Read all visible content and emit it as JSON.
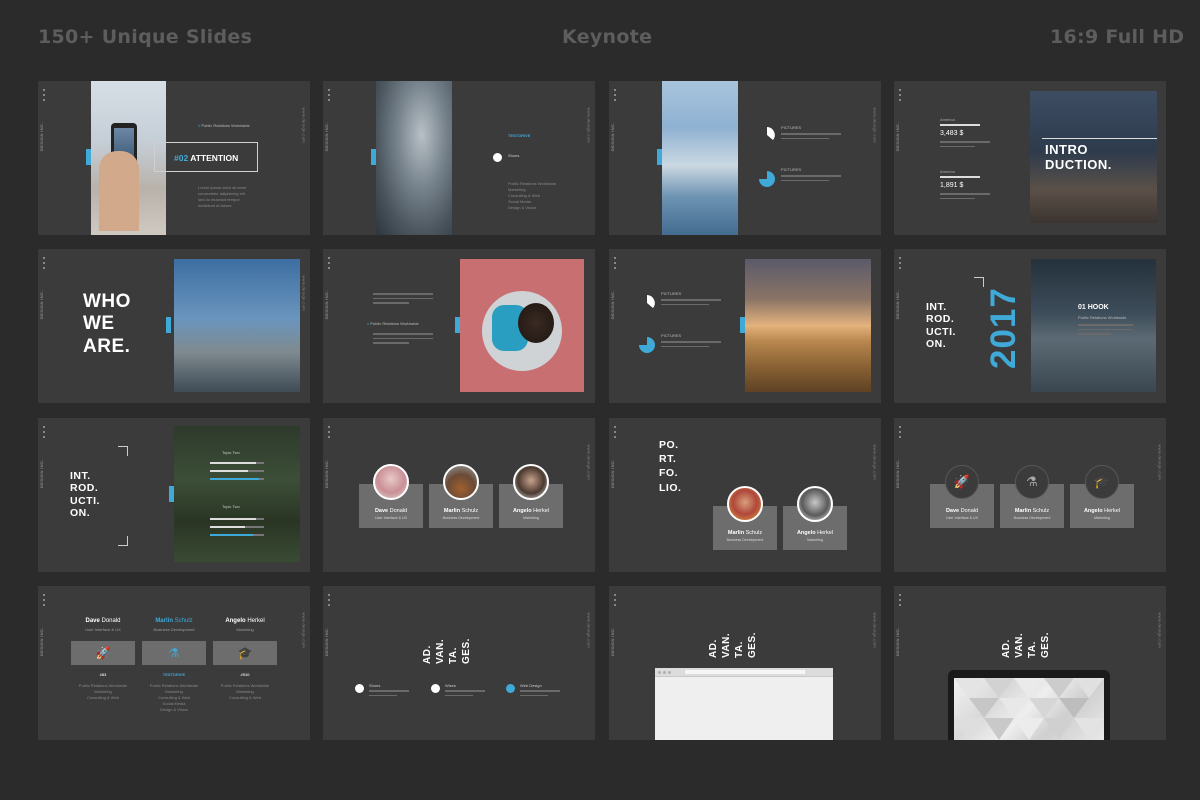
{
  "header": {
    "left": "150+ Unique Slides",
    "center": "Keynote",
    "right": "16:9 Full HD"
  },
  "common": {
    "brand": "DESIGN INC.",
    "side": "www.design.com"
  },
  "s1": {
    "subtitle": "Public Relations Worldwide",
    "box_num": "#02",
    "box_word": "ATTENTION",
    "lines": [
      "Lorem ipsum dolor sit amet",
      "consectetur adipisicing elit",
      "sed do eiusmod tempor",
      "incididunt ut labore"
    ]
  },
  "s2": {
    "label": "TESTDRIVE",
    "item": "Shoes",
    "list": [
      "Public Relations Worldwide",
      "Marketing",
      "Consulting & Web",
      "Social Media",
      "Design & Vision"
    ]
  },
  "s3": {
    "label1": "PICTURES",
    "label2": "PICTURES"
  },
  "s4": {
    "r1_label": "America",
    "r1_value": "3,483 $",
    "r2_label": "America",
    "r2_value": "1,891 $",
    "intro_l1": "INTRO",
    "intro_l2": "DUCTION."
  },
  "s5": {
    "l1": "WHO",
    "l2": "WE",
    "l3": "ARE."
  },
  "s6": {
    "subtitle": "Public Relations Worldwide"
  },
  "s7": {
    "label1": "PICTURES",
    "label2": "PICTURES"
  },
  "s8": {
    "l1": "INT.",
    "l2": "ROD.",
    "l3": "UCTI.",
    "l4": "ON.",
    "year": "2017",
    "hook": "01 HOOK",
    "hook_sub": "Public Relations Worldwide"
  },
  "s9": {
    "l1": "INT.",
    "l2": "ROD.",
    "l3": "UCTI.",
    "l4": "ON.",
    "topic1": "Topic Two",
    "topic2": "Topic Two"
  },
  "s10": {
    "members": [
      {
        "first": "Dave",
        "last": "Donald",
        "role": "User Interface & UX"
      },
      {
        "first": "Marlin",
        "last": "Schulz",
        "role": "Business Development"
      },
      {
        "first": "Angelo",
        "last": "Herkel",
        "role": "Marketing"
      }
    ]
  },
  "s11": {
    "l1": "PO.",
    "l2": "RT.",
    "l3": "FO.",
    "l4": "LIO.",
    "members": [
      {
        "first": "Marlin",
        "last": "Schulz",
        "role": "Business Development"
      },
      {
        "first": "Angelo",
        "last": "Herkel",
        "role": "Marketing"
      }
    ]
  },
  "s12": {
    "members": [
      {
        "first": "Dave",
        "last": "Donald",
        "role": "User Interface & UX"
      },
      {
        "first": "Marlin",
        "last": "Schulz",
        "role": "Business Development"
      },
      {
        "first": "Angelo",
        "last": "Herkel",
        "role": "Marketing"
      }
    ]
  },
  "s13": {
    "cols": [
      {
        "first": "Dave",
        "last": "Donald",
        "role": "User Interface & UX",
        "num": "#83",
        "tag": "",
        "items": [
          "Public Relations Worldwide",
          "Marketing",
          "Consulting & Web"
        ]
      },
      {
        "first": "Marlin",
        "last": "Schulz",
        "role": "Business Development",
        "num": "",
        "tag": "TESTDRIVE",
        "items": [
          "Public Relations Worldwide",
          "Marketing",
          "Consulting & Web",
          "Social Media",
          "Design & Vision"
        ]
      },
      {
        "first": "Angelo",
        "last": "Herkel",
        "role": "Marketing",
        "num": "#510",
        "tag": "",
        "items": [
          "Public Relations Worldwide",
          "Marketing",
          "Consulting & Web"
        ]
      }
    ]
  },
  "s14": {
    "l1": "AD.",
    "l2": "VAN.",
    "l3": "TA.",
    "l4": "GES.",
    "items": [
      "Shoes",
      "Wises",
      "Web Design"
    ]
  },
  "s15": {
    "l1": "AD.",
    "l2": "VAN.",
    "l3": "TA.",
    "l4": "GES."
  },
  "s16": {
    "l1": "AD.",
    "l2": "VAN.",
    "l3": "TA.",
    "l4": "GES."
  },
  "colors": {
    "background": "#2b2b2b",
    "slide": "#3b3b3b",
    "accent": "#3fa9d8",
    "card": "#6d6d6d"
  }
}
